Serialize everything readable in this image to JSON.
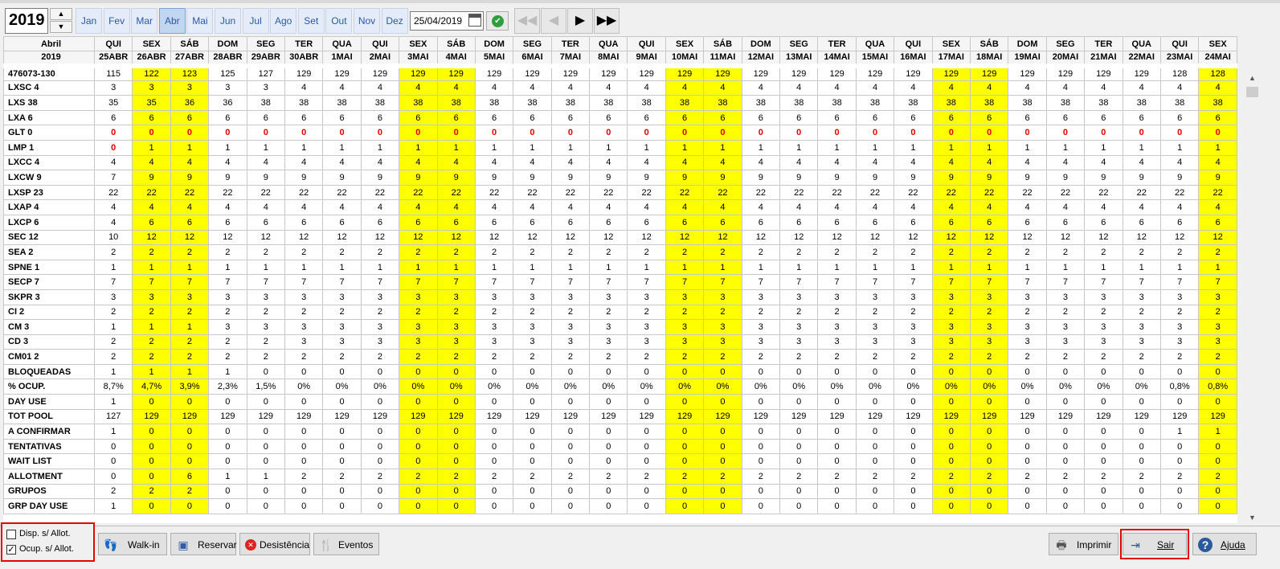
{
  "toolbar": {
    "year": "2019",
    "months": [
      "Jan",
      "Fev",
      "Mar",
      "Abr",
      "Mai",
      "Jun",
      "Jul",
      "Ago",
      "Set",
      "Out",
      "Nov",
      "Dez"
    ],
    "selected_month": "Abr",
    "date_value": "25/04/2019",
    "spin_up": "▲",
    "spin_down": "▼",
    "nav": {
      "first": "◀◀",
      "prev": "◀",
      "next": "▶",
      "last": "▶▶"
    }
  },
  "grid": {
    "month_label": "Abril",
    "year_label": "2019",
    "weekdays": [
      "QUI",
      "SEX",
      "SÁB",
      "DOM",
      "SEG",
      "TER",
      "QUA",
      "QUI",
      "SEX",
      "SÁB",
      "DOM",
      "SEG",
      "TER",
      "QUA",
      "QUI",
      "SEX",
      "SÁB",
      "DOM",
      "SEG",
      "TER",
      "QUA",
      "QUI",
      "SEX",
      "SÁB",
      "DOM",
      "SEG",
      "TER",
      "QUA",
      "QUI",
      "SEX"
    ],
    "dates": [
      "25ABR",
      "26ABR",
      "27ABR",
      "28ABR",
      "29ABR",
      "30ABR",
      "1MAI",
      "2MAI",
      "3MAI",
      "4MAI",
      "5MAI",
      "6MAI",
      "7MAI",
      "8MAI",
      "9MAI",
      "10MAI",
      "11MAI",
      "12MAI",
      "13MAI",
      "14MAI",
      "15MAI",
      "16MAI",
      "17MAI",
      "18MAI",
      "19MAI",
      "20MAI",
      "21MAI",
      "22MAI",
      "23MAI",
      "24MAI"
    ],
    "highlight_columns": [
      1,
      2,
      8,
      9,
      15,
      16,
      22,
      23,
      29
    ],
    "highlight_color": "#ffff00",
    "alert_color": "#e00000",
    "rows": [
      {
        "label": "476073-130",
        "values": [
          "115",
          "122",
          "123",
          "125",
          "127",
          "129",
          "129",
          "129",
          "129",
          "129",
          "129",
          "129",
          "129",
          "129",
          "129",
          "129",
          "129",
          "129",
          "129",
          "129",
          "129",
          "129",
          "129",
          "129",
          "129",
          "129",
          "129",
          "129",
          "128",
          "128"
        ]
      },
      {
        "label": "LXSC 4",
        "values": [
          "3",
          "3",
          "3",
          "3",
          "3",
          "4",
          "4",
          "4",
          "4",
          "4",
          "4",
          "4",
          "4",
          "4",
          "4",
          "4",
          "4",
          "4",
          "4",
          "4",
          "4",
          "4",
          "4",
          "4",
          "4",
          "4",
          "4",
          "4",
          "4",
          "4"
        ]
      },
      {
        "label": "LXS  38",
        "values": [
          "35",
          "35",
          "36",
          "36",
          "38",
          "38",
          "38",
          "38",
          "38",
          "38",
          "38",
          "38",
          "38",
          "38",
          "38",
          "38",
          "38",
          "38",
          "38",
          "38",
          "38",
          "38",
          "38",
          "38",
          "38",
          "38",
          "38",
          "38",
          "38",
          "38"
        ]
      },
      {
        "label": "LXA  6",
        "values": [
          "6",
          "6",
          "6",
          "6",
          "6",
          "6",
          "6",
          "6",
          "6",
          "6",
          "6",
          "6",
          "6",
          "6",
          "6",
          "6",
          "6",
          "6",
          "6",
          "6",
          "6",
          "6",
          "6",
          "6",
          "6",
          "6",
          "6",
          "6",
          "6",
          "6"
        ]
      },
      {
        "label": "GLT  0",
        "red": true,
        "values": [
          "0",
          "0",
          "0",
          "0",
          "0",
          "0",
          "0",
          "0",
          "0",
          "0",
          "0",
          "0",
          "0",
          "0",
          "0",
          "0",
          "0",
          "0",
          "0",
          "0",
          "0",
          "0",
          "0",
          "0",
          "0",
          "0",
          "0",
          "0",
          "0",
          "0"
        ]
      },
      {
        "label": "LMP  1",
        "red_first": true,
        "values": [
          "0",
          "1",
          "1",
          "1",
          "1",
          "1",
          "1",
          "1",
          "1",
          "1",
          "1",
          "1",
          "1",
          "1",
          "1",
          "1",
          "1",
          "1",
          "1",
          "1",
          "1",
          "1",
          "1",
          "1",
          "1",
          "1",
          "1",
          "1",
          "1",
          "1"
        ]
      },
      {
        "label": "LXCC 4",
        "values": [
          "4",
          "4",
          "4",
          "4",
          "4",
          "4",
          "4",
          "4",
          "4",
          "4",
          "4",
          "4",
          "4",
          "4",
          "4",
          "4",
          "4",
          "4",
          "4",
          "4",
          "4",
          "4",
          "4",
          "4",
          "4",
          "4",
          "4",
          "4",
          "4",
          "4"
        ]
      },
      {
        "label": "LXCW 9",
        "values": [
          "7",
          "9",
          "9",
          "9",
          "9",
          "9",
          "9",
          "9",
          "9",
          "9",
          "9",
          "9",
          "9",
          "9",
          "9",
          "9",
          "9",
          "9",
          "9",
          "9",
          "9",
          "9",
          "9",
          "9",
          "9",
          "9",
          "9",
          "9",
          "9",
          "9"
        ]
      },
      {
        "label": "LXSP 23",
        "values": [
          "22",
          "22",
          "22",
          "22",
          "22",
          "22",
          "22",
          "22",
          "22",
          "22",
          "22",
          "22",
          "22",
          "22",
          "22",
          "22",
          "22",
          "22",
          "22",
          "22",
          "22",
          "22",
          "22",
          "22",
          "22",
          "22",
          "22",
          "22",
          "22",
          "22"
        ]
      },
      {
        "label": "LXAP 4",
        "values": [
          "4",
          "4",
          "4",
          "4",
          "4",
          "4",
          "4",
          "4",
          "4",
          "4",
          "4",
          "4",
          "4",
          "4",
          "4",
          "4",
          "4",
          "4",
          "4",
          "4",
          "4",
          "4",
          "4",
          "4",
          "4",
          "4",
          "4",
          "4",
          "4",
          "4"
        ]
      },
      {
        "label": "LXCP 6",
        "values": [
          "4",
          "6",
          "6",
          "6",
          "6",
          "6",
          "6",
          "6",
          "6",
          "6",
          "6",
          "6",
          "6",
          "6",
          "6",
          "6",
          "6",
          "6",
          "6",
          "6",
          "6",
          "6",
          "6",
          "6",
          "6",
          "6",
          "6",
          "6",
          "6",
          "6"
        ]
      },
      {
        "label": "SEC  12",
        "values": [
          "10",
          "12",
          "12",
          "12",
          "12",
          "12",
          "12",
          "12",
          "12",
          "12",
          "12",
          "12",
          "12",
          "12",
          "12",
          "12",
          "12",
          "12",
          "12",
          "12",
          "12",
          "12",
          "12",
          "12",
          "12",
          "12",
          "12",
          "12",
          "12",
          "12"
        ]
      },
      {
        "label": "SEA  2",
        "values": [
          "2",
          "2",
          "2",
          "2",
          "2",
          "2",
          "2",
          "2",
          "2",
          "2",
          "2",
          "2",
          "2",
          "2",
          "2",
          "2",
          "2",
          "2",
          "2",
          "2",
          "2",
          "2",
          "2",
          "2",
          "2",
          "2",
          "2",
          "2",
          "2",
          "2"
        ]
      },
      {
        "label": "SPNE 1",
        "values": [
          "1",
          "1",
          "1",
          "1",
          "1",
          "1",
          "1",
          "1",
          "1",
          "1",
          "1",
          "1",
          "1",
          "1",
          "1",
          "1",
          "1",
          "1",
          "1",
          "1",
          "1",
          "1",
          "1",
          "1",
          "1",
          "1",
          "1",
          "1",
          "1",
          "1"
        ]
      },
      {
        "label": "SECP 7",
        "values": [
          "7",
          "7",
          "7",
          "7",
          "7",
          "7",
          "7",
          "7",
          "7",
          "7",
          "7",
          "7",
          "7",
          "7",
          "7",
          "7",
          "7",
          "7",
          "7",
          "7",
          "7",
          "7",
          "7",
          "7",
          "7",
          "7",
          "7",
          "7",
          "7",
          "7"
        ]
      },
      {
        "label": "SKPR 3",
        "values": [
          "3",
          "3",
          "3",
          "3",
          "3",
          "3",
          "3",
          "3",
          "3",
          "3",
          "3",
          "3",
          "3",
          "3",
          "3",
          "3",
          "3",
          "3",
          "3",
          "3",
          "3",
          "3",
          "3",
          "3",
          "3",
          "3",
          "3",
          "3",
          "3",
          "3"
        ]
      },
      {
        "label": "CI  2",
        "values": [
          "2",
          "2",
          "2",
          "2",
          "2",
          "2",
          "2",
          "2",
          "2",
          "2",
          "2",
          "2",
          "2",
          "2",
          "2",
          "2",
          "2",
          "2",
          "2",
          "2",
          "2",
          "2",
          "2",
          "2",
          "2",
          "2",
          "2",
          "2",
          "2",
          "2"
        ]
      },
      {
        "label": "CM  3",
        "values": [
          "1",
          "1",
          "1",
          "3",
          "3",
          "3",
          "3",
          "3",
          "3",
          "3",
          "3",
          "3",
          "3",
          "3",
          "3",
          "3",
          "3",
          "3",
          "3",
          "3",
          "3",
          "3",
          "3",
          "3",
          "3",
          "3",
          "3",
          "3",
          "3",
          "3"
        ]
      },
      {
        "label": "CD  3",
        "values": [
          "2",
          "2",
          "2",
          "2",
          "2",
          "3",
          "3",
          "3",
          "3",
          "3",
          "3",
          "3",
          "3",
          "3",
          "3",
          "3",
          "3",
          "3",
          "3",
          "3",
          "3",
          "3",
          "3",
          "3",
          "3",
          "3",
          "3",
          "3",
          "3",
          "3"
        ]
      },
      {
        "label": "CM01 2",
        "values": [
          "2",
          "2",
          "2",
          "2",
          "2",
          "2",
          "2",
          "2",
          "2",
          "2",
          "2",
          "2",
          "2",
          "2",
          "2",
          "2",
          "2",
          "2",
          "2",
          "2",
          "2",
          "2",
          "2",
          "2",
          "2",
          "2",
          "2",
          "2",
          "2",
          "2"
        ]
      },
      {
        "label": "BLOQUEADAS",
        "values": [
          "1",
          "1",
          "1",
          "1",
          "0",
          "0",
          "0",
          "0",
          "0",
          "0",
          "0",
          "0",
          "0",
          "0",
          "0",
          "0",
          "0",
          "0",
          "0",
          "0",
          "0",
          "0",
          "0",
          "0",
          "0",
          "0",
          "0",
          "0",
          "0",
          "0"
        ]
      },
      {
        "label": "% OCUP.",
        "values": [
          "8,7%",
          "4,7%",
          "3,9%",
          "2,3%",
          "1,5%",
          "0%",
          "0%",
          "0%",
          "0%",
          "0%",
          "0%",
          "0%",
          "0%",
          "0%",
          "0%",
          "0%",
          "0%",
          "0%",
          "0%",
          "0%",
          "0%",
          "0%",
          "0%",
          "0%",
          "0%",
          "0%",
          "0%",
          "0%",
          "0,8%",
          "0,8%"
        ]
      },
      {
        "label": "DAY USE",
        "values": [
          "1",
          "0",
          "0",
          "0",
          "0",
          "0",
          "0",
          "0",
          "0",
          "0",
          "0",
          "0",
          "0",
          "0",
          "0",
          "0",
          "0",
          "0",
          "0",
          "0",
          "0",
          "0",
          "0",
          "0",
          "0",
          "0",
          "0",
          "0",
          "0",
          "0"
        ]
      },
      {
        "label": "TOT POOL",
        "values": [
          "127",
          "129",
          "129",
          "129",
          "129",
          "129",
          "129",
          "129",
          "129",
          "129",
          "129",
          "129",
          "129",
          "129",
          "129",
          "129",
          "129",
          "129",
          "129",
          "129",
          "129",
          "129",
          "129",
          "129",
          "129",
          "129",
          "129",
          "129",
          "129",
          "129"
        ]
      },
      {
        "label": "A CONFIRMAR",
        "values": [
          "1",
          "0",
          "0",
          "0",
          "0",
          "0",
          "0",
          "0",
          "0",
          "0",
          "0",
          "0",
          "0",
          "0",
          "0",
          "0",
          "0",
          "0",
          "0",
          "0",
          "0",
          "0",
          "0",
          "0",
          "0",
          "0",
          "0",
          "0",
          "1",
          "1"
        ]
      },
      {
        "label": "TENTATIVAS",
        "values": [
          "0",
          "0",
          "0",
          "0",
          "0",
          "0",
          "0",
          "0",
          "0",
          "0",
          "0",
          "0",
          "0",
          "0",
          "0",
          "0",
          "0",
          "0",
          "0",
          "0",
          "0",
          "0",
          "0",
          "0",
          "0",
          "0",
          "0",
          "0",
          "0",
          "0"
        ]
      },
      {
        "label": "WAIT LIST",
        "values": [
          "0",
          "0",
          "0",
          "0",
          "0",
          "0",
          "0",
          "0",
          "0",
          "0",
          "0",
          "0",
          "0",
          "0",
          "0",
          "0",
          "0",
          "0",
          "0",
          "0",
          "0",
          "0",
          "0",
          "0",
          "0",
          "0",
          "0",
          "0",
          "0",
          "0"
        ]
      },
      {
        "label": "ALLOTMENT",
        "values": [
          "0",
          "0",
          "6",
          "1",
          "1",
          "2",
          "2",
          "2",
          "2",
          "2",
          "2",
          "2",
          "2",
          "2",
          "2",
          "2",
          "2",
          "2",
          "2",
          "2",
          "2",
          "2",
          "2",
          "2",
          "2",
          "2",
          "2",
          "2",
          "2",
          "2"
        ]
      },
      {
        "label": "GRUPOS",
        "values": [
          "2",
          "2",
          "2",
          "0",
          "0",
          "0",
          "0",
          "0",
          "0",
          "0",
          "0",
          "0",
          "0",
          "0",
          "0",
          "0",
          "0",
          "0",
          "0",
          "0",
          "0",
          "0",
          "0",
          "0",
          "0",
          "0",
          "0",
          "0",
          "0",
          "0"
        ]
      },
      {
        "label": "GRP DAY USE",
        "values": [
          "1",
          "0",
          "0",
          "0",
          "0",
          "0",
          "0",
          "0",
          "0",
          "0",
          "0",
          "0",
          "0",
          "0",
          "0",
          "0",
          "0",
          "0",
          "0",
          "0",
          "0",
          "0",
          "0",
          "0",
          "0",
          "0",
          "0",
          "0",
          "0",
          "0"
        ]
      }
    ]
  },
  "bottom": {
    "chk_disp": "Disp. s/ Allot.",
    "chk_ocup": "Ocup. s/ Allot.",
    "chk_ocup_checked": "✓",
    "walkin": "Walk-in",
    "reservar": "Reservar",
    "desistencia": "Desistência",
    "eventos": "Eventos",
    "imprimir": "Imprimir",
    "sair": "Sair",
    "ajuda": "Ajuda"
  },
  "scroll": {
    "up": "▲",
    "down": "▼"
  }
}
